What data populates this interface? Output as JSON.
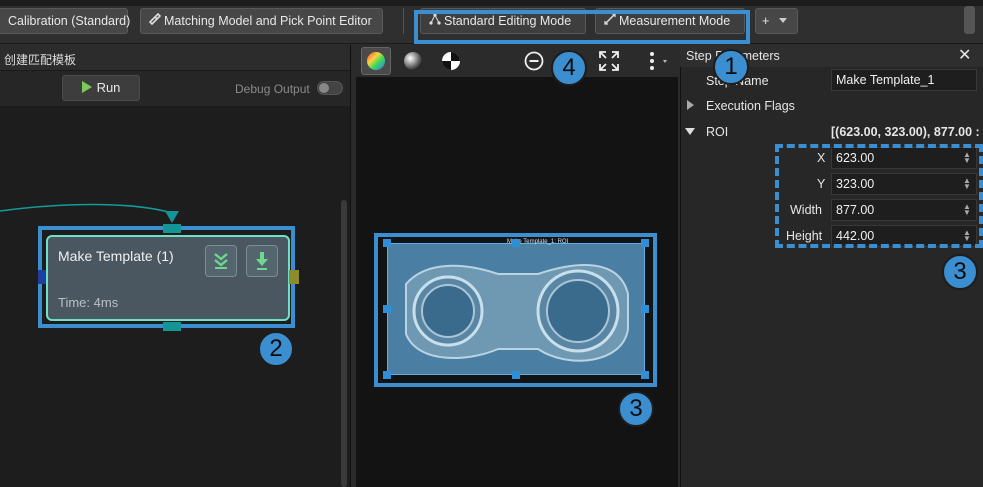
{
  "toolbar": {
    "calibration_label": "Calibration (Standard)",
    "editor_label": "Matching Model and Pick Point Editor",
    "standard_mode_label": "Standard Editing Mode",
    "measurement_mode_label": "Measurement Mode",
    "add_label": "+"
  },
  "left_panel": {
    "title": "创建匹配模板",
    "run_label": "Run",
    "debug_label": "Debug Output",
    "debug_enabled": false,
    "node": {
      "title": "Make Template (1)",
      "time": "Time: 4ms"
    }
  },
  "viewer": {
    "roi_label": "Make Template_1: ROI"
  },
  "properties": {
    "title": "Step Parameters",
    "step_name_label": "Step Name",
    "step_name_value": "Make Template_1",
    "execution_flags_label": "Execution Flags",
    "roi_label": "ROI",
    "roi_summary": "[(623.00, 323.00), 877.00 :",
    "x_label": "X",
    "x_value": "623.00",
    "y_label": "Y",
    "y_value": "323.00",
    "width_label": "Width",
    "width_value": "877.00",
    "height_label": "Height",
    "height_value": "442.00"
  },
  "callouts": {
    "one": "1",
    "two": "2",
    "three_a": "3",
    "three_b": "3",
    "four": "4"
  },
  "colors": {
    "accent": "#3b8fd0",
    "node_border": "#6fe0c8",
    "run_green": "#7ccb5a"
  }
}
